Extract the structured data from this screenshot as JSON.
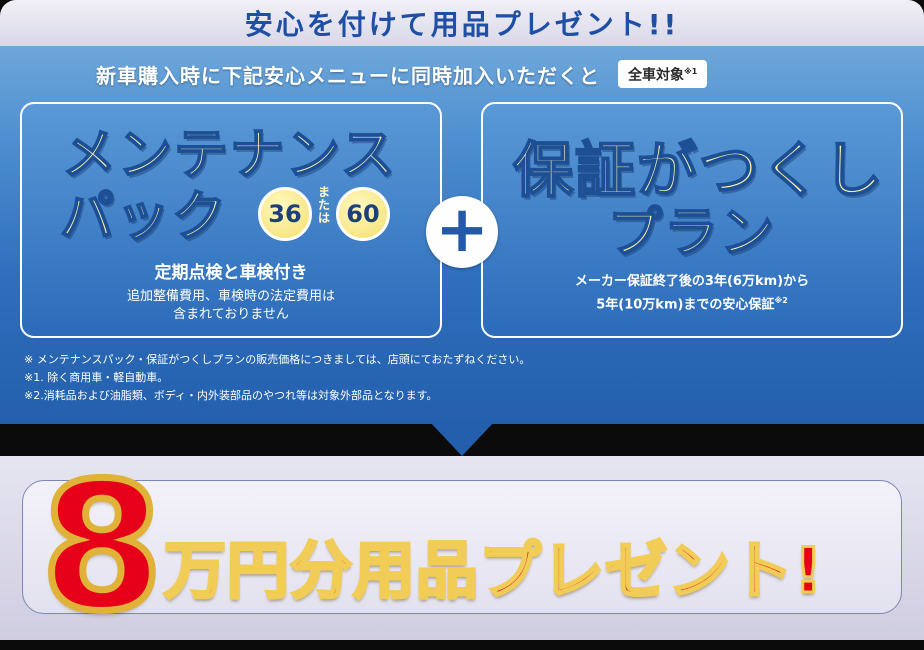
{
  "header": {
    "title": "安心を付けて用品プレゼント!!"
  },
  "subtitle": {
    "text": "新車購入時に下記安心メニューに同時加入いただくと",
    "badge": "全車対象",
    "badge_note": "※1"
  },
  "maintenance_pack": {
    "title_line1": "メンテナンス",
    "title_line2": "パック",
    "option_a": "36",
    "or_text": "または",
    "option_b": "60",
    "inspection_text": "定期点検と車検付き",
    "extra_line1": "追加整備費用、車検時の法定費用は",
    "extra_line2": "含まれておりません"
  },
  "plus_symbol": "+",
  "warranty_plan": {
    "title_line1": "保証がつくし",
    "title_line2": "プラン",
    "desc_line1": "メーカー保証終了後の3年(6万km)から",
    "desc_line2": "5年(10万km)までの安心保証",
    "desc_note": "※2"
  },
  "notes": [
    "※ メンテナンスパック・保証がつくしプランの販売価格につきましては、店頭にておたずねください。",
    "※1. 除く商用車・軽自動車。",
    "※2.消耗品および油脂類、ボディ・内外装部品のやつれ等は対象外部品となります。"
  ],
  "present": {
    "number": "8",
    "text": "万円分用品プレゼント!"
  },
  "colors": {
    "accent_red": "#e7001a",
    "gold": "#e0b238",
    "blue": "#235fad",
    "cream": "#fbf3b0"
  }
}
